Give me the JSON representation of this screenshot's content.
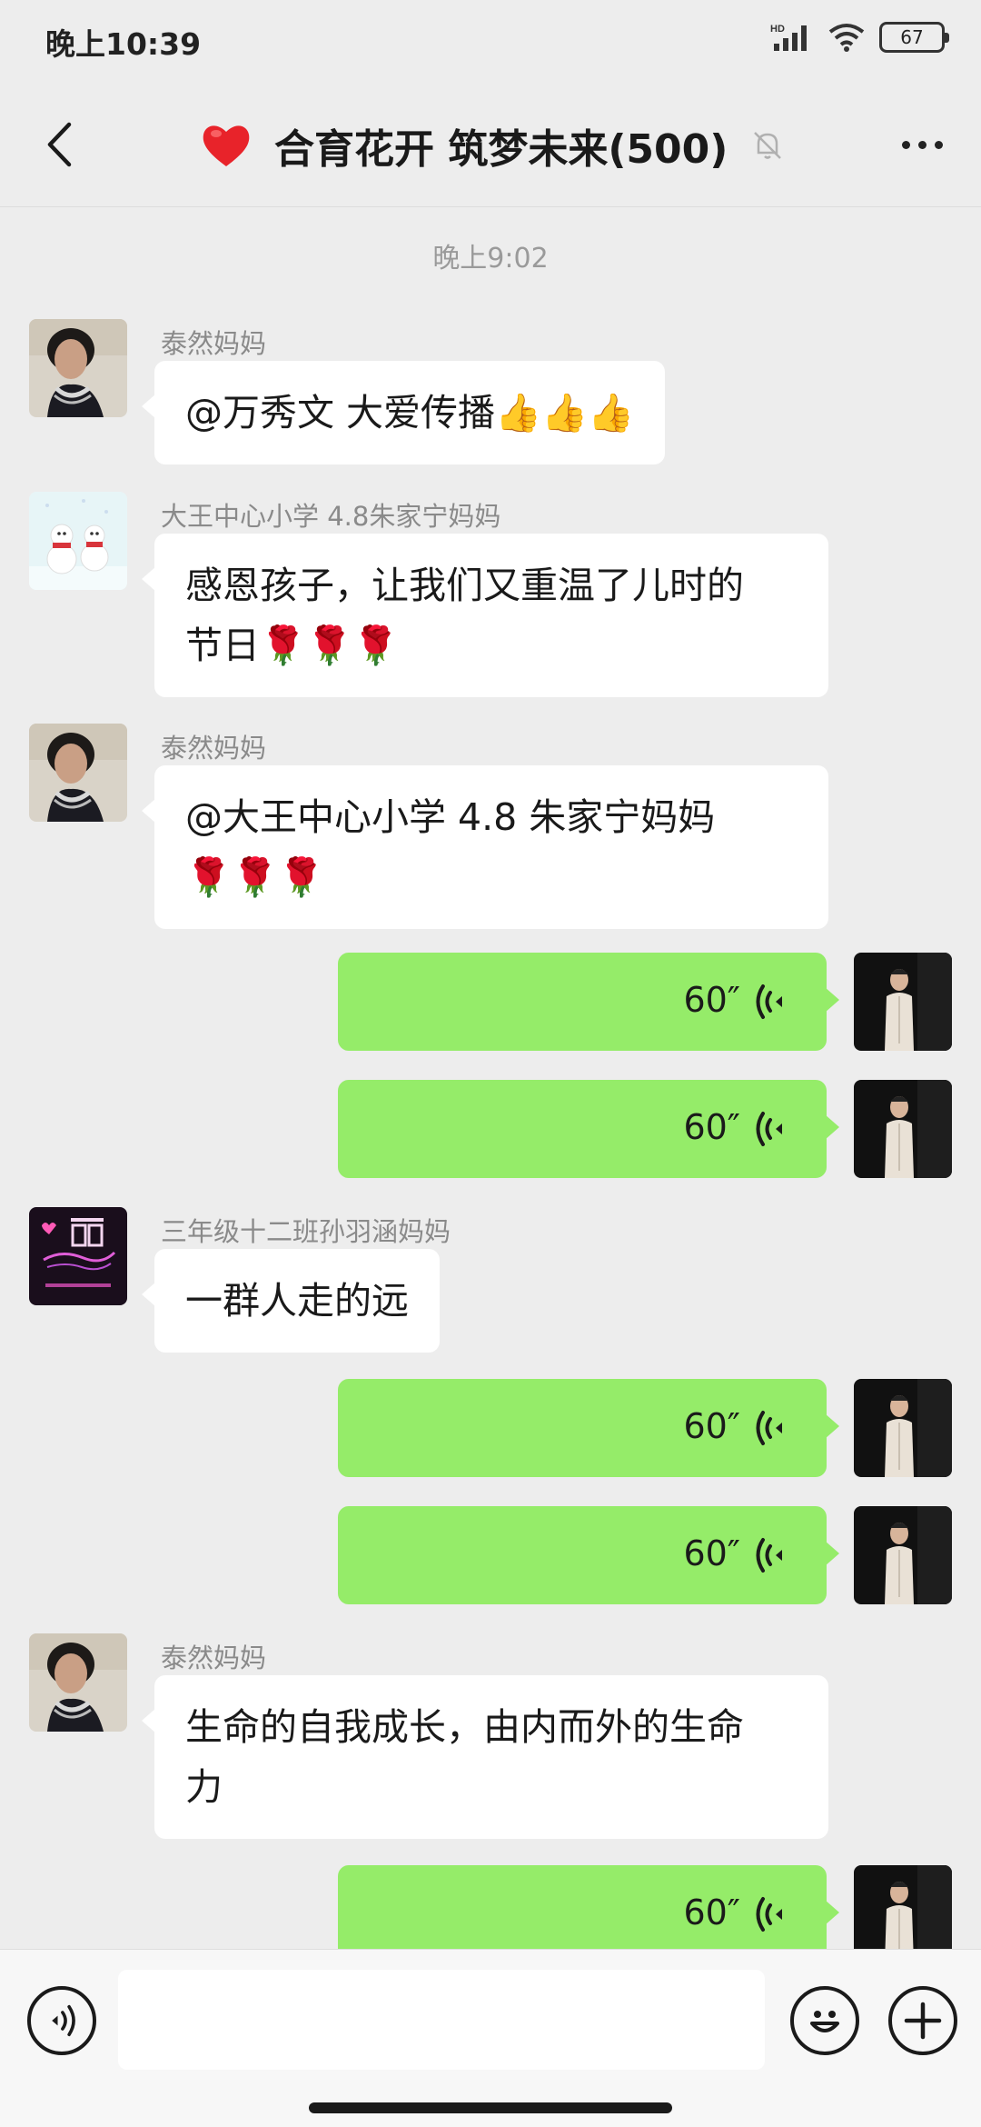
{
  "status_bar": {
    "time": "晚上10:39",
    "hd_label": "HD",
    "battery": "67"
  },
  "header": {
    "title": "合育花开 筑梦未来(500)",
    "title_emoji": "❤️"
  },
  "chat": {
    "time_separator": "晚上9:02",
    "messages": [
      {
        "sender": "泰然妈妈",
        "text": "@万秀文  大爱传播👍👍👍"
      },
      {
        "sender": "大王中心小学 4.8朱家宁妈妈",
        "text_line1": "感恩孩子，让我们又重温了儿时的",
        "text_line2": "节日🌹🌹🌹"
      },
      {
        "sender": "泰然妈妈",
        "text_line1": "@大王中心小学 4.8 朱家宁妈妈",
        "text_line2": "🌹🌹🌹"
      },
      {
        "voice_duration": "60″"
      },
      {
        "voice_duration": "60″"
      },
      {
        "sender": "三年级十二班孙羽涵妈妈",
        "text": "一群人走的远"
      },
      {
        "voice_duration": "60″"
      },
      {
        "voice_duration": "60″"
      },
      {
        "sender": "泰然妈妈",
        "text_line1": "生命的自我成长，由内而外的生命",
        "text_line2": "力"
      },
      {
        "voice_duration": "60″"
      }
    ]
  },
  "input": {
    "placeholder": ""
  },
  "colors": {
    "background": "#ededed",
    "outgoing_bubble": "#95ec69",
    "incoming_bubble": "#ffffff"
  }
}
